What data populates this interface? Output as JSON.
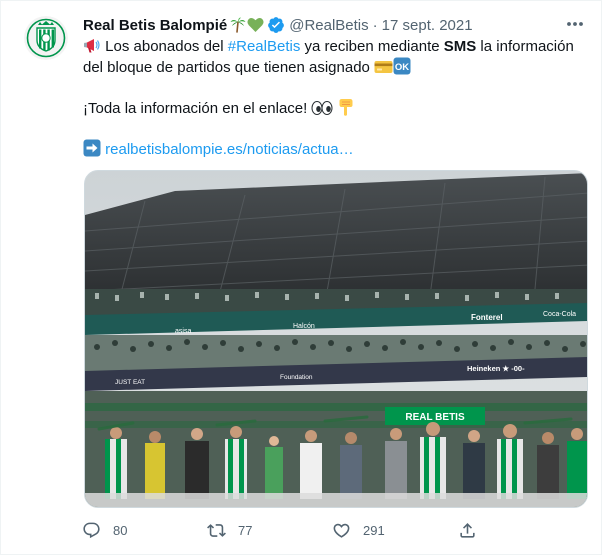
{
  "tweet": {
    "display_name": "Real Betis Balompié",
    "name_emojis": [
      "palm-tree-emoji",
      "green-heart-emoji"
    ],
    "handle": "@RealBetis",
    "separator": "·",
    "date": "17 sept. 2021",
    "text": {
      "line1_pre": "Los abonados del ",
      "hashtag": "#RealBetis",
      "line1_mid": " ya reciben mediante ",
      "sms": "SMS",
      "line1_post": " la información",
      "line2": "del bloque de partidos que tienen asignado",
      "line3": "¡Toda la información en el enlace! ",
      "link": "realbetisbalompie.es/noticias/actua…"
    },
    "media": {
      "banner_text": "REAL BETIS",
      "sponsor_1": "Fonterel",
      "sponsor_2": "Heineken ★ -00-",
      "sponsor_3": "Foundation",
      "sponsor_4": "Halcón",
      "sponsor_5": "Coca-Cola",
      "sponsor_6": "JUST EAT",
      "sponsor_7": "asisa"
    },
    "metrics": {
      "replies": "80",
      "retweets": "77",
      "likes": "291"
    }
  },
  "colors": {
    "accent": "#1d9bf0",
    "muted": "#536471",
    "text": "#0f1419",
    "betis_green": "#00954c"
  },
  "icons": [
    "verified-badge-icon",
    "more-icon",
    "reply-icon",
    "retweet-icon",
    "like-icon",
    "share-icon",
    "megaphone-emoji",
    "credit-card-emoji",
    "ok-button-emoji",
    "eyes-emoji",
    "pointing-down-emoji",
    "right-arrow-emoji"
  ]
}
